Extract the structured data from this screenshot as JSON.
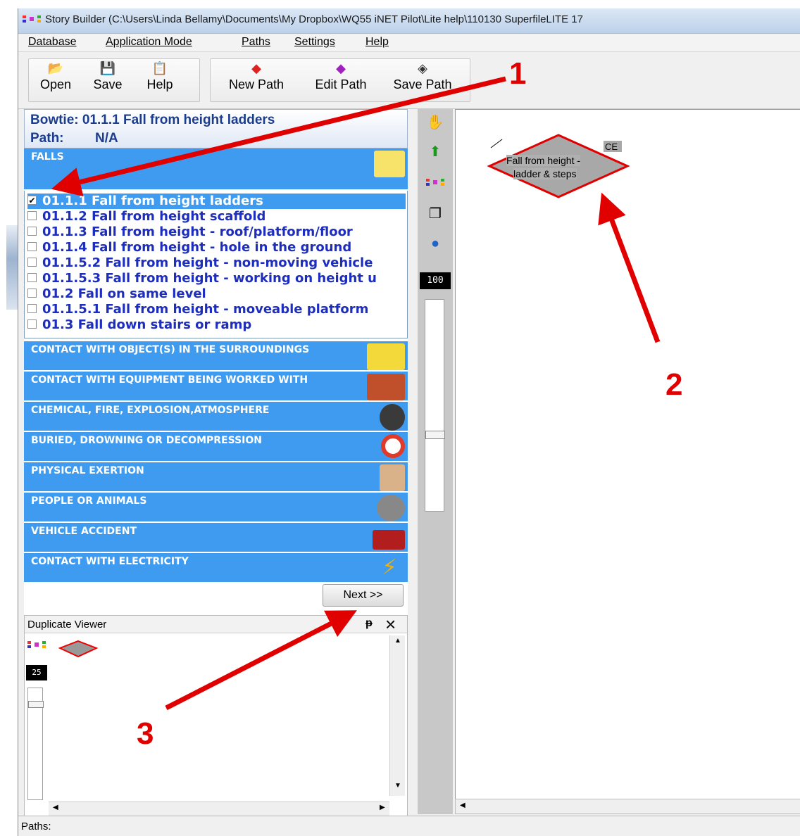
{
  "window": {
    "title": "Story Builder (C:\\Users\\Linda Bellamy\\Documents\\My Dropbox\\WQ55 iNET Pilot\\Lite help\\110130 SuperfileLITE 17"
  },
  "menu": {
    "items": [
      "Database",
      "Application Mode",
      "Paths",
      "Settings",
      "Help"
    ]
  },
  "toolbar": {
    "open": "Open",
    "save": "Save",
    "help": "Help",
    "new_path": "New Path",
    "edit_path": "Edit Path",
    "save_path": "Save Path"
  },
  "bowtie": {
    "label": "Bowtie: 01.1.1 Fall from height ladders",
    "path_label": "Path:",
    "path_value": "N/A"
  },
  "categories": {
    "falls": "FALLS",
    "contact_objects": "CONTACT WITH OBJECT(S) IN THE SURROUNDINGS",
    "contact_equipment": "CONTACT WITH EQUIPMENT BEING WORKED WITH",
    "chemical": "CHEMICAL, FIRE, EXPLOSION,ATMOSPHERE",
    "buried": "BURIED, DROWNING OR DECOMPRESSION",
    "physical": "PHYSICAL EXERTION",
    "people": "PEOPLE OR ANIMALS",
    "vehicle": "VEHICLE ACCIDENT",
    "electricity": "CONTACT WITH ELECTRICITY"
  },
  "falls_items": [
    {
      "label": "01.1.1 Fall from height ladders",
      "checked": true
    },
    {
      "label": "01.1.2 Fall from height scaffold",
      "checked": false
    },
    {
      "label": "01.1.3 Fall from height - roof/platform/floor",
      "checked": false
    },
    {
      "label": "01.1.4 Fall from height - hole in the ground",
      "checked": false
    },
    {
      "label": "01.1.5.2 Fall from height - non-moving vehicle",
      "checked": false
    },
    {
      "label": "01.1.5.3 Fall from height - working on height u",
      "checked": false
    },
    {
      "label": "01.2 Fall on same level",
      "checked": false
    },
    {
      "label": "01.1.5.1 Fall from height - moveable platform",
      "checked": false
    },
    {
      "label": "01.3 Fall down stairs or ramp",
      "checked": false
    }
  ],
  "next_button": "Next >>",
  "duplicate_viewer": {
    "title": "Duplicate Viewer",
    "zoom": "25"
  },
  "tools": {
    "zoom": "100"
  },
  "canvas": {
    "node_text_line1": "Fall from height -",
    "node_text_line2": "ladder & steps",
    "node_tag": "CE"
  },
  "status": {
    "text": "Paths:"
  },
  "callouts": [
    "1",
    "2",
    "3"
  ],
  "colors": {
    "category_blue": "#3f9bf0",
    "list_text_blue": "#1d2dbd",
    "arrow_red": "#e00000",
    "node_fill": "#a8a8a8",
    "node_border": "#e00000"
  }
}
